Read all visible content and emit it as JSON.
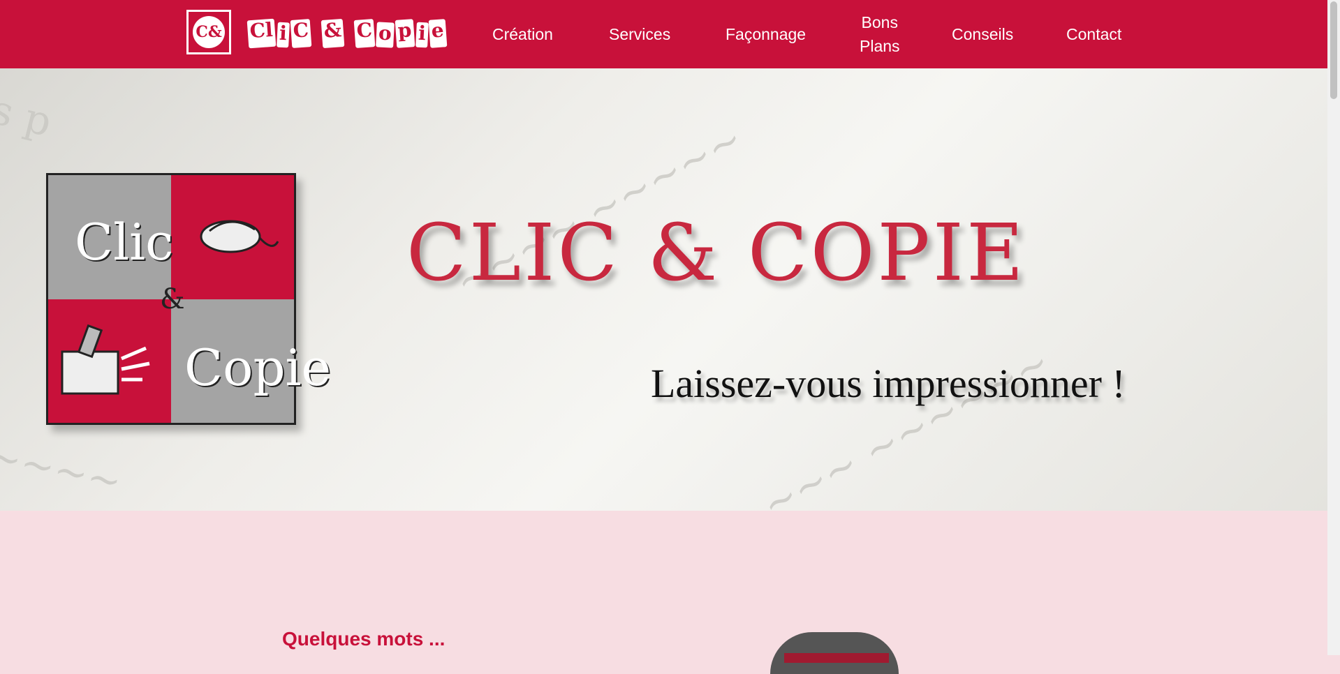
{
  "header": {
    "logo_monogram": "C&",
    "brand_parts": [
      "Cl",
      "i",
      "C",
      "&",
      "C",
      "o",
      "p",
      "i",
      "e"
    ],
    "nav": [
      {
        "label": "Création"
      },
      {
        "label": "Services"
      },
      {
        "label": "Façonnage"
      },
      {
        "label_line1": "Bons",
        "label_line2": "Plans"
      },
      {
        "label": "Conseils"
      },
      {
        "label": "Contact"
      }
    ],
    "brand_color": "#c8113a"
  },
  "hero": {
    "logo_word_top": "Clic",
    "logo_amp": "&",
    "logo_word_bottom": "Copie",
    "title": "CLIC & COPIE",
    "tagline": "Laissez-vous impressionner !",
    "title_color": "#c8283f"
  },
  "content": {
    "heading": "Quelques mots ..."
  },
  "icons": [
    "mouse-icon",
    "printer-icon"
  ]
}
